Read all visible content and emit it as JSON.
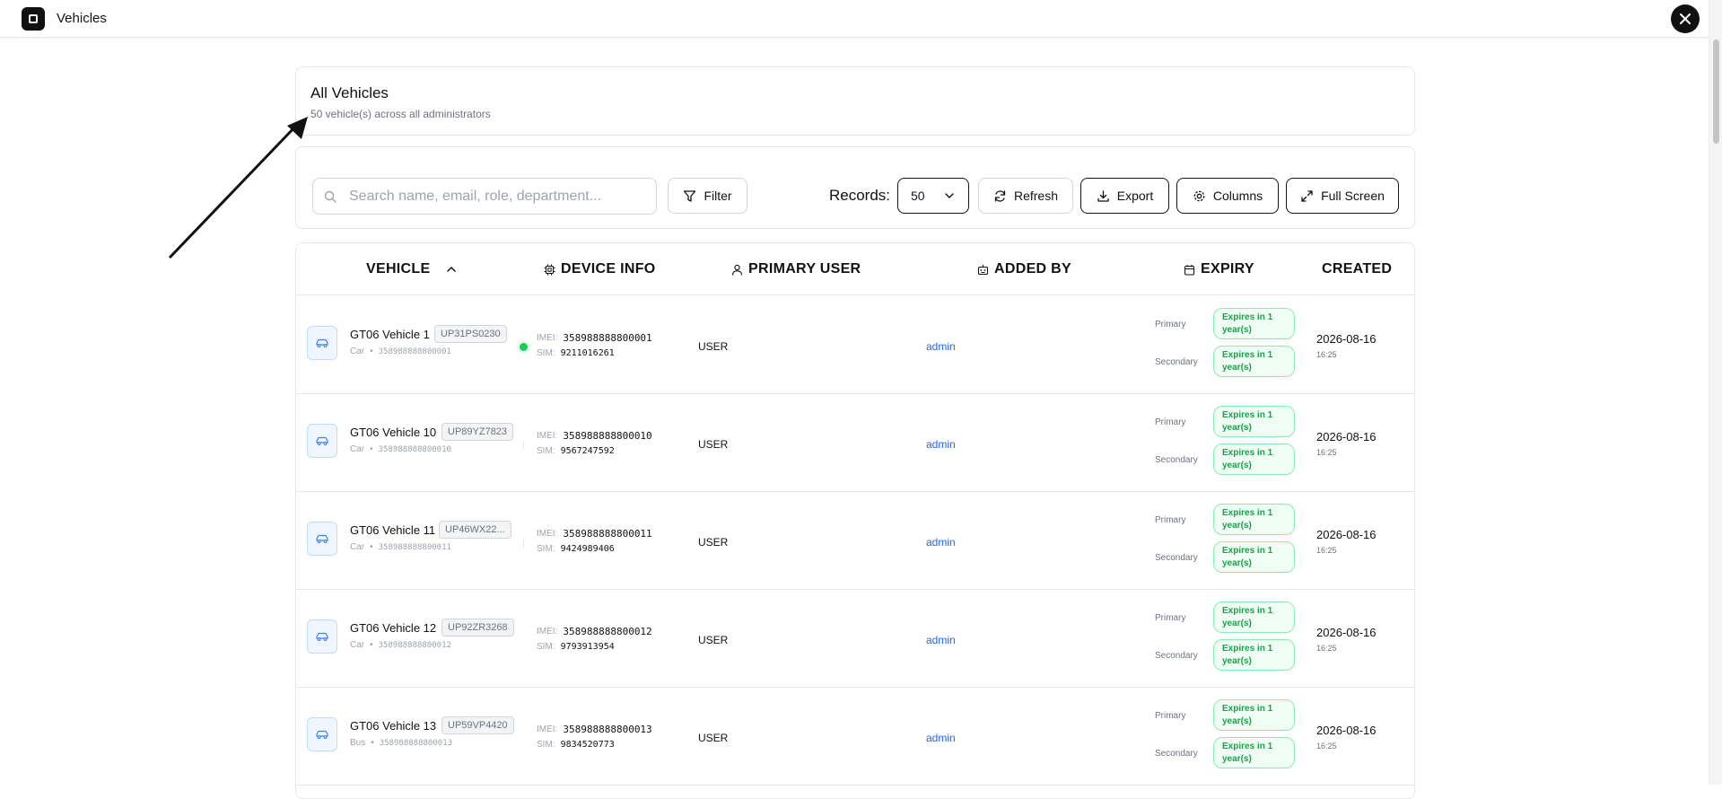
{
  "app": {
    "title": "Vehicles",
    "close_icon": "close-icon"
  },
  "header": {
    "title": "All Vehicles",
    "subtitle": "50 vehicle(s) across all administrators"
  },
  "toolbar": {
    "search_placeholder": "Search name, email, role, department...",
    "filter_label": "Filter",
    "records_label": "Records:",
    "records_value": "50",
    "refresh_label": "Refresh",
    "export_label": "Export",
    "columns_label": "Columns",
    "fullscreen_label": "Full Screen"
  },
  "table": {
    "columns": {
      "vehicle": "VEHICLE",
      "device_info": "DEVICE INFO",
      "primary_user": "PRIMARY USER",
      "added_by": "ADDED BY",
      "expiry": "EXPIRY",
      "created": "CREATED"
    },
    "labels": {
      "imei": "IMEI:",
      "sim": "SIM:",
      "primary": "Primary",
      "secondary": "Secondary",
      "bullet": "•"
    },
    "rows": [
      {
        "name": "GT06 Vehicle 1",
        "plate": "UP31PS0230",
        "type": "Car",
        "device_id": "358988888800001",
        "imei": "358988888800001",
        "sim": "9211016261",
        "primary_user": "USER",
        "added_by": "admin",
        "primary_expiry": "Expires in 1 year(s)",
        "secondary_expiry": "Expires in 1 year(s)",
        "created_date": "2026-08-16",
        "created_time": "16:25",
        "status": "online"
      },
      {
        "name": "GT06 Vehicle 10",
        "plate": "UP89YZ7823",
        "type": "Car",
        "device_id": "358988888800010",
        "imei": "358988888800010",
        "sim": "9567247592",
        "primary_user": "USER",
        "added_by": "admin",
        "primary_expiry": "Expires in 1 year(s)",
        "secondary_expiry": "Expires in 1 year(s)",
        "created_date": "2026-08-16",
        "created_time": "16:25",
        "status": "none"
      },
      {
        "name": "GT06 Vehicle 11",
        "plate": "UP46WX22...",
        "type": "Car",
        "device_id": "358988888800011",
        "imei": "358988888800011",
        "sim": "9424989406",
        "primary_user": "USER",
        "added_by": "admin",
        "primary_expiry": "Expires in 1 year(s)",
        "secondary_expiry": "Expires in 1 year(s)",
        "created_date": "2026-08-16",
        "created_time": "16:25",
        "status": "none"
      },
      {
        "name": "GT06 Vehicle 12",
        "plate": "UP92ZR3268",
        "type": "Car",
        "device_id": "358988888800012",
        "imei": "358988888800012",
        "sim": "9793913954",
        "primary_user": "USER",
        "added_by": "admin",
        "primary_expiry": "Expires in 1 year(s)",
        "secondary_expiry": "Expires in 1 year(s)",
        "created_date": "2026-08-16",
        "created_time": "16:25",
        "status": "none"
      },
      {
        "name": "GT06 Vehicle 13",
        "plate": "UP59VP4420",
        "type": "Bus",
        "device_id": "358988888800013",
        "imei": "358988888800013",
        "sim": "9834520773",
        "primary_user": "USER",
        "added_by": "admin",
        "primary_expiry": "Expires in 1 year(s)",
        "secondary_expiry": "Expires in 1 year(s)",
        "created_date": "2026-08-16",
        "created_time": "16:25",
        "status": "none"
      }
    ]
  }
}
